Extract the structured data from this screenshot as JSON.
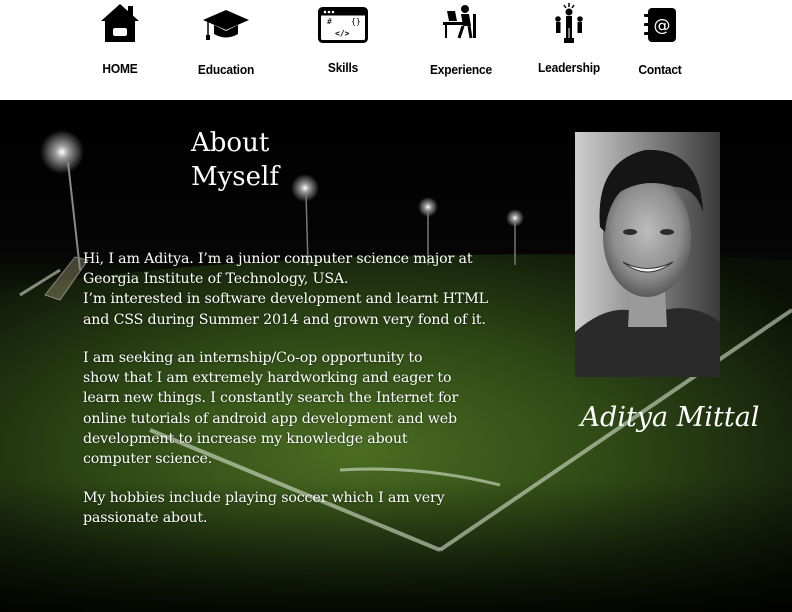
{
  "nav": {
    "items": [
      {
        "label": "HOME",
        "icon": "home-icon"
      },
      {
        "label": "Education",
        "icon": "graduation-cap-icon"
      },
      {
        "label": "Skills",
        "icon": "code-window-icon"
      },
      {
        "label": "Experience",
        "icon": "desk-worker-icon"
      },
      {
        "label": "Leadership",
        "icon": "leader-group-icon"
      },
      {
        "label": "Contact",
        "icon": "contact-book-icon"
      }
    ]
  },
  "about": {
    "heading_line1": "About",
    "heading_line2": "Myself",
    "para1_line1": "Hi, I am Aditya. I’m a junior computer science major at",
    "para1_line2": "Georgia Institute of Technology, USA.",
    "para1_line3": "I’m interested in software development and learnt HTML",
    "para1_line4": "and CSS during Summer 2014 and grown very fond of it.",
    "para2_line1": "I am seeking an internship/Co-op opportunity to",
    "para2_line2": "show that I am extremely hardworking and eager to",
    "para2_line3": "learn new things. I constantly search the Internet for",
    "para2_line4": "online tutorials of android app development and web",
    "para2_line5": "development to increase my knowledge about",
    "para2_line6": "computer science.",
    "para3_line1": "My hobbies include playing soccer which I am very",
    "para3_line2": "passionate about."
  },
  "profile": {
    "name": "Aditya Mittal",
    "photo": "profile-photo"
  },
  "colors": {
    "nav_bg": "#ffffff",
    "nav_text": "#000000",
    "hero_text": "#ffffff",
    "field_green": "#3a5a1c"
  }
}
